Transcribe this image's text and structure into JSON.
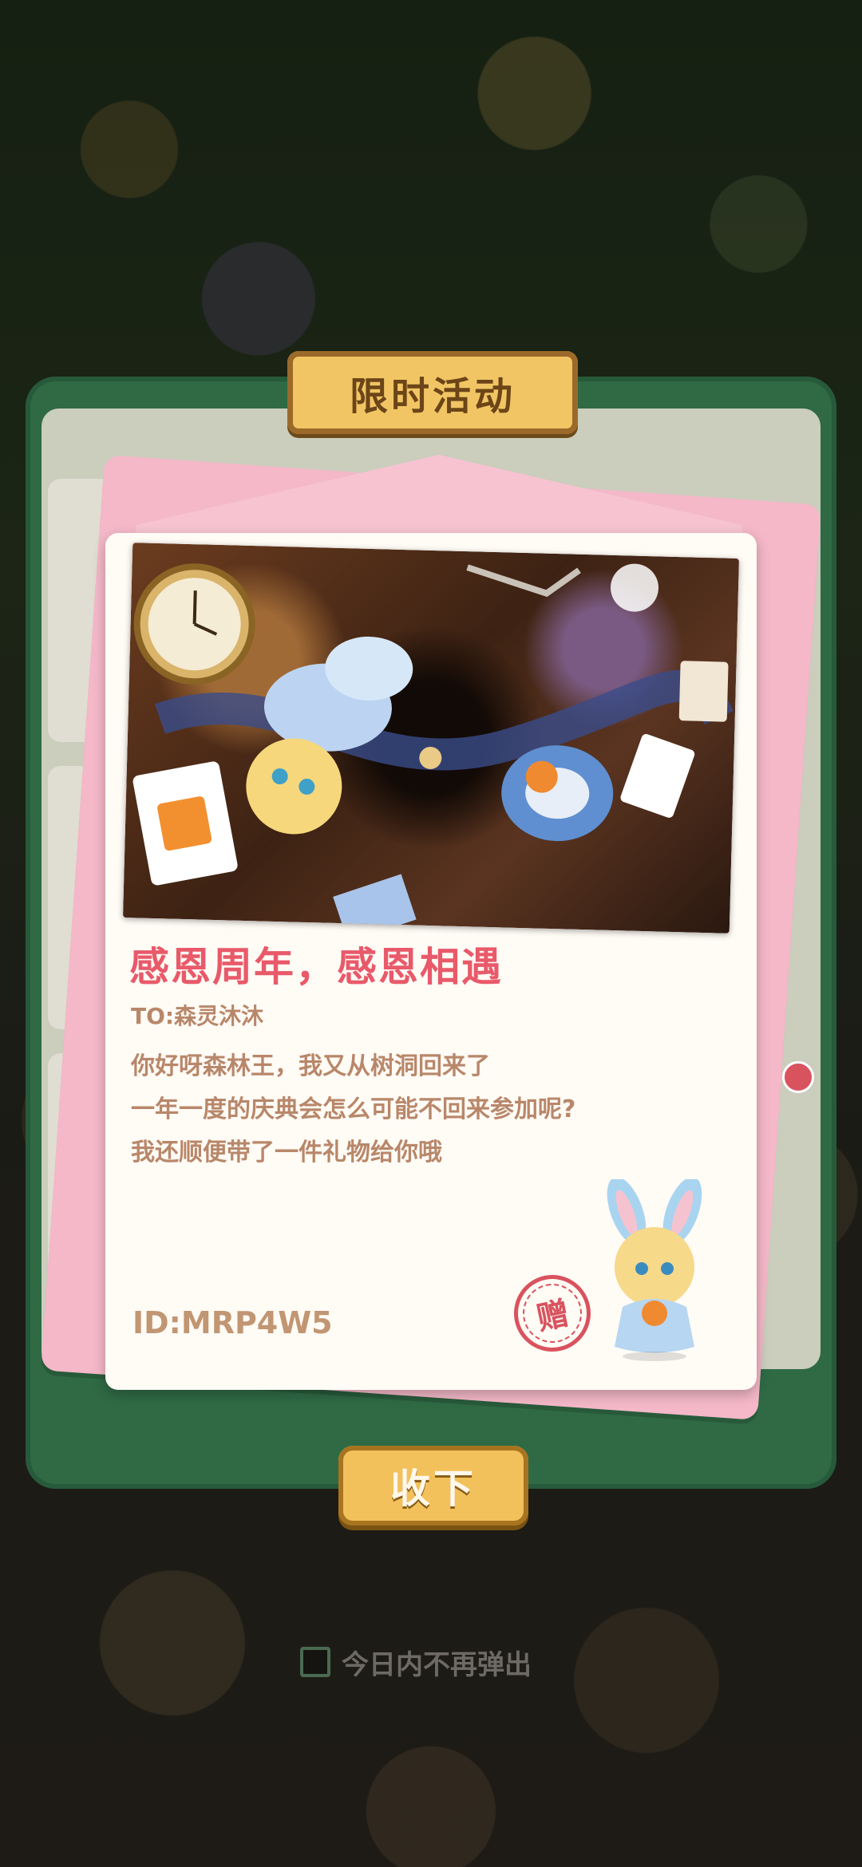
{
  "event_panel": {
    "title": "限时活动"
  },
  "letter": {
    "headline": "感恩周年，感恩相遇",
    "recipient": "TO:森灵沐沐",
    "message_lines": [
      "你好呀森林王，我又从树洞回来了",
      "一年一度的庆典会怎么可能不回来参加呢?",
      "我还顺便带了一件礼物给你哦"
    ],
    "id_label": "ID:MRP4W5",
    "stamp_text": "赠"
  },
  "actions": {
    "accept_label": "收下",
    "dismiss_today_label": "今日内不再弹出",
    "dismiss_checked": false
  },
  "colors": {
    "headline": "#e85a6a",
    "body_text": "#b8876a",
    "button": "#f3c15b",
    "panel": "#2f6a45",
    "envelope": "#f4b8c8"
  }
}
